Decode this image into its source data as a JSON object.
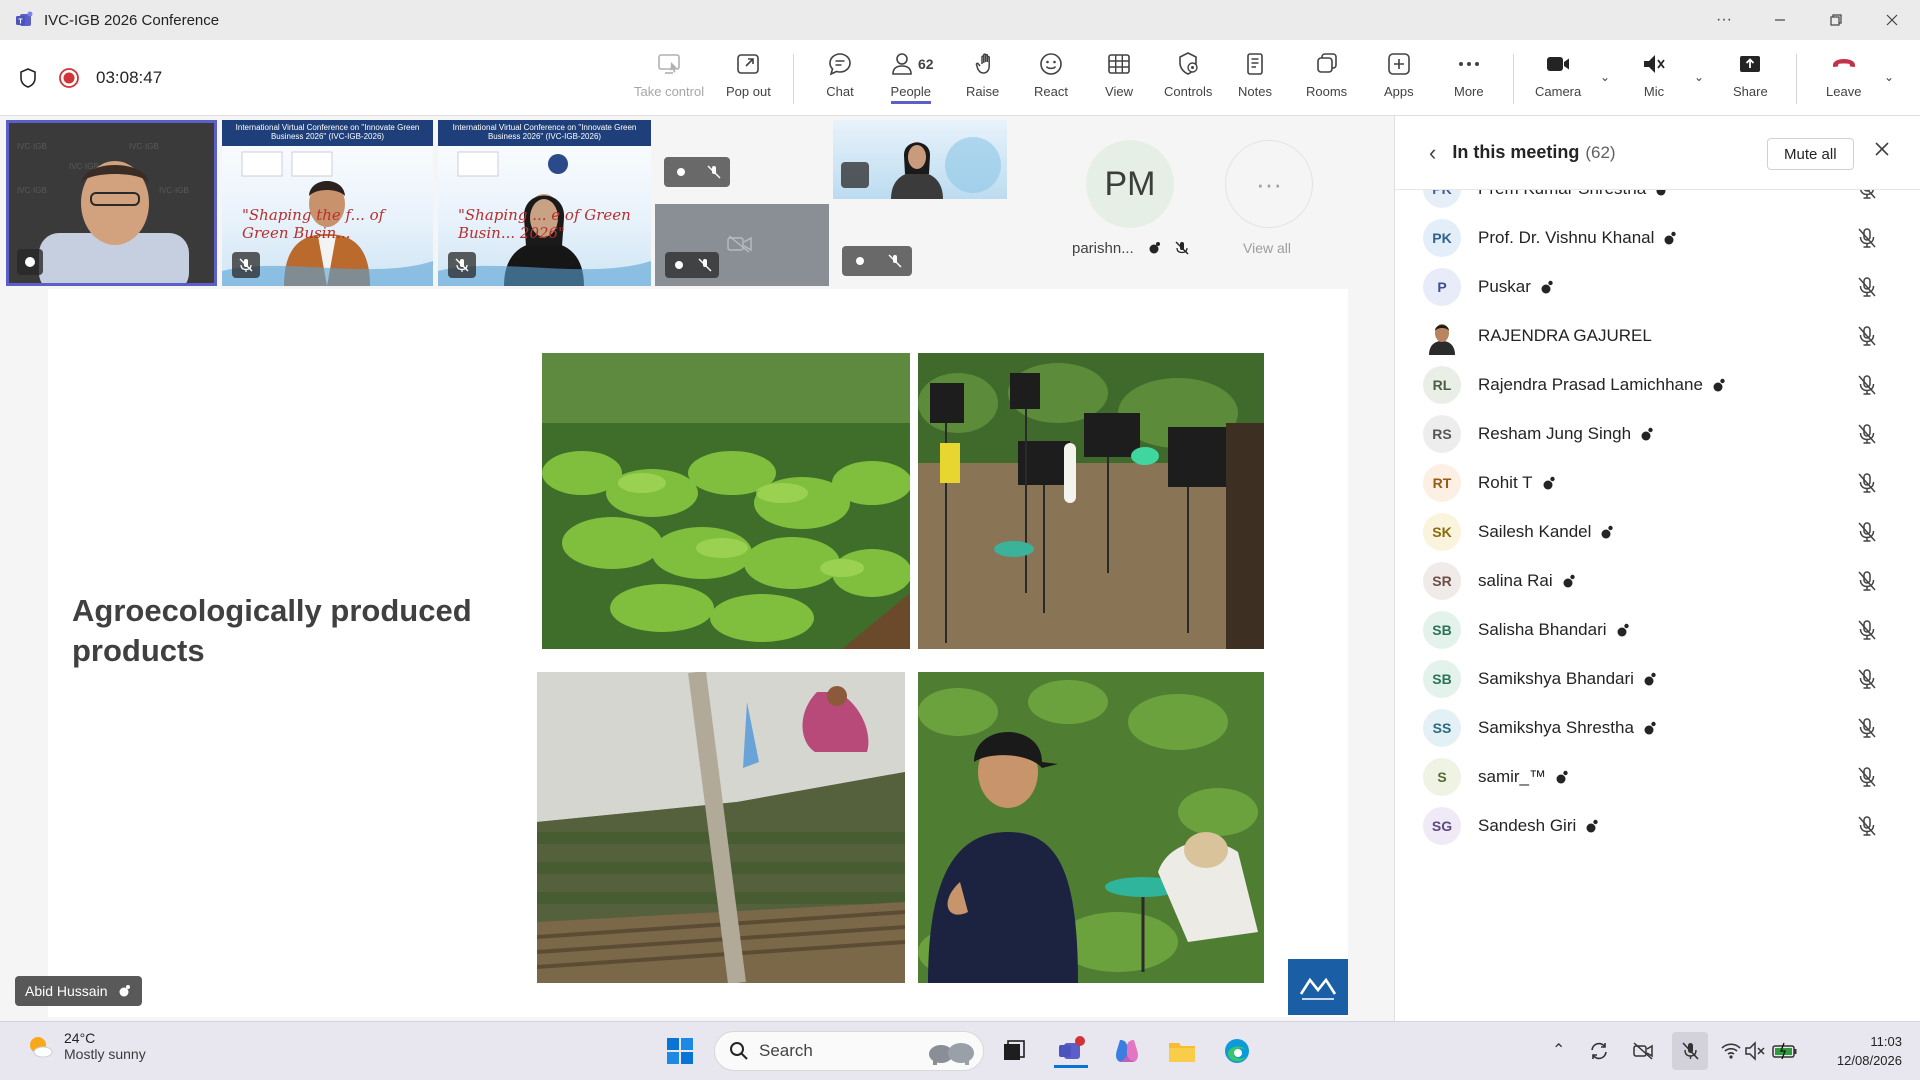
{
  "window": {
    "title": "IVC-IGB 2026 Conference",
    "more_label": "···"
  },
  "toolbar": {
    "timer": "03:08:47",
    "buttons": {
      "take_control": "Take control",
      "pop_out": "Pop out",
      "chat": "Chat",
      "people": "People",
      "people_count": "62",
      "raise": "Raise",
      "react": "React",
      "view": "View",
      "controls": "Controls",
      "notes": "Notes",
      "rooms": "Rooms",
      "apps": "Apps",
      "more": "More",
      "camera": "Camera",
      "mic": "Mic",
      "share": "Share",
      "leave": "Leave"
    }
  },
  "stage": {
    "thumb_posters": [
      {
        "header": "International Virtual Conference on \"Innovate Green Business 2026\" (IVC-IGB-2026)",
        "slogan": "\"Shaping the f... of Green Busin..."
      },
      {
        "header": "International Virtual Conference on \"Innovate Green Business 2026\" (IVC-IGB-2026)",
        "slogan": "\"Shaping ... e of Green Busin... 2026\""
      }
    ],
    "pm_initials": "PM",
    "pm_name": "parishn...",
    "view_all": "View all",
    "view_all_dots": "···",
    "presenter_name": "Abid Hussain"
  },
  "slide": {
    "title": "Agroecologically produced products"
  },
  "panel": {
    "title": "In this meeting",
    "count": "(62)",
    "mute_all": "Mute all",
    "participants": [
      {
        "initials": "PK",
        "name": "Prem Kumar Shrestha",
        "color": "#e6eef7",
        "text_color": "#3a5f8f"
      },
      {
        "initials": "PK",
        "name": "Prof. Dr. Vishnu Khanal",
        "color": "#e3eef8",
        "text_color": "#34608c"
      },
      {
        "initials": "P",
        "name": "Puskar",
        "color": "#e8ecf8",
        "text_color": "#3f4f8f"
      },
      {
        "initials": "",
        "name": "RAJENDRA GAJUREL",
        "color": "#c9b9a6",
        "text_color": "#3a2a1a",
        "photo": true
      },
      {
        "initials": "RL",
        "name": "Rajendra Prasad Lamichhane",
        "color": "#e9eee6",
        "text_color": "#4b5e45"
      },
      {
        "initials": "RS",
        "name": "Resham Jung Singh",
        "color": "#ededed",
        "text_color": "#555555"
      },
      {
        "initials": "RT",
        "name": "Rohit T",
        "color": "#fbf0e3",
        "text_color": "#9a5a16"
      },
      {
        "initials": "SK",
        "name": "Sailesh Kandel",
        "color": "#fbf4dc",
        "text_color": "#8a6a10"
      },
      {
        "initials": "SR",
        "name": "salina Rai",
        "color": "#f0ebe9",
        "text_color": "#6b4f45"
      },
      {
        "initials": "SB",
        "name": "Salisha Bhandari",
        "color": "#e3f3ec",
        "text_color": "#2e7258"
      },
      {
        "initials": "SB",
        "name": "Samikshya Bhandari",
        "color": "#e3f3ec",
        "text_color": "#2e7258"
      },
      {
        "initials": "SS",
        "name": "Samikshya Shrestha",
        "color": "#e3f1f6",
        "text_color": "#2d6a80"
      },
      {
        "initials": "S",
        "name": "samir_™",
        "color": "#eef3e4",
        "text_color": "#566b30"
      },
      {
        "initials": "SG",
        "name": "Sandesh Giri",
        "color": "#efeaf5",
        "text_color": "#5d4a7e"
      }
    ]
  },
  "taskbar": {
    "temperature": "24°C",
    "weather": "Mostly sunny",
    "search_placeholder": "Search",
    "time": "11:03",
    "date": "12/08/2026"
  },
  "colors": {
    "accent": "#5b5fc7",
    "leave_red": "#c4314b",
    "record_red": "#d13438"
  }
}
